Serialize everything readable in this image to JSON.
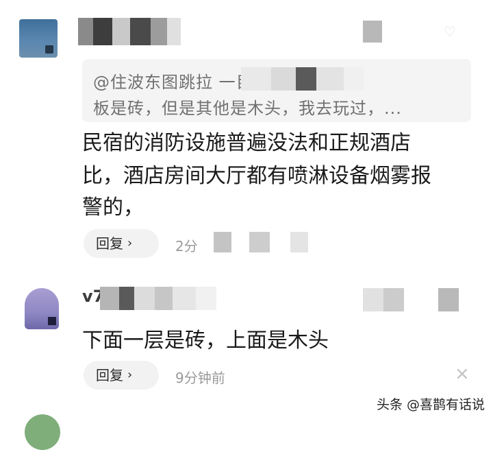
{
  "comments": [
    {
      "quote_line_1": "@住波东图跳拉    一目邦：估计是地",
      "quote_line_2": "板是砖，但是其他是木头，我去玩过，...",
      "text_line_1": "民宿的消防设施普遍没法和正规酒店",
      "text_line_2": "比，酒店房间大厅都有喷淋设备烟雾报",
      "text_line_3": "警的，",
      "reply_label": "回复",
      "time": "2分",
      "chevron": "›",
      "close": "×"
    },
    {
      "username": "v7",
      "text_line_1": "下面一层是砖，上面是木头",
      "reply_label": "回复",
      "time": "9分钟前",
      "chevron": "›",
      "close": "×"
    }
  ],
  "watermark": "头条 @喜鹊有话说",
  "colors": {
    "background": "#ffffff",
    "quote_bg": "#f4f4f4",
    "reply_bg": "#f2f2f2",
    "meta_text": "#9a9a9a"
  }
}
